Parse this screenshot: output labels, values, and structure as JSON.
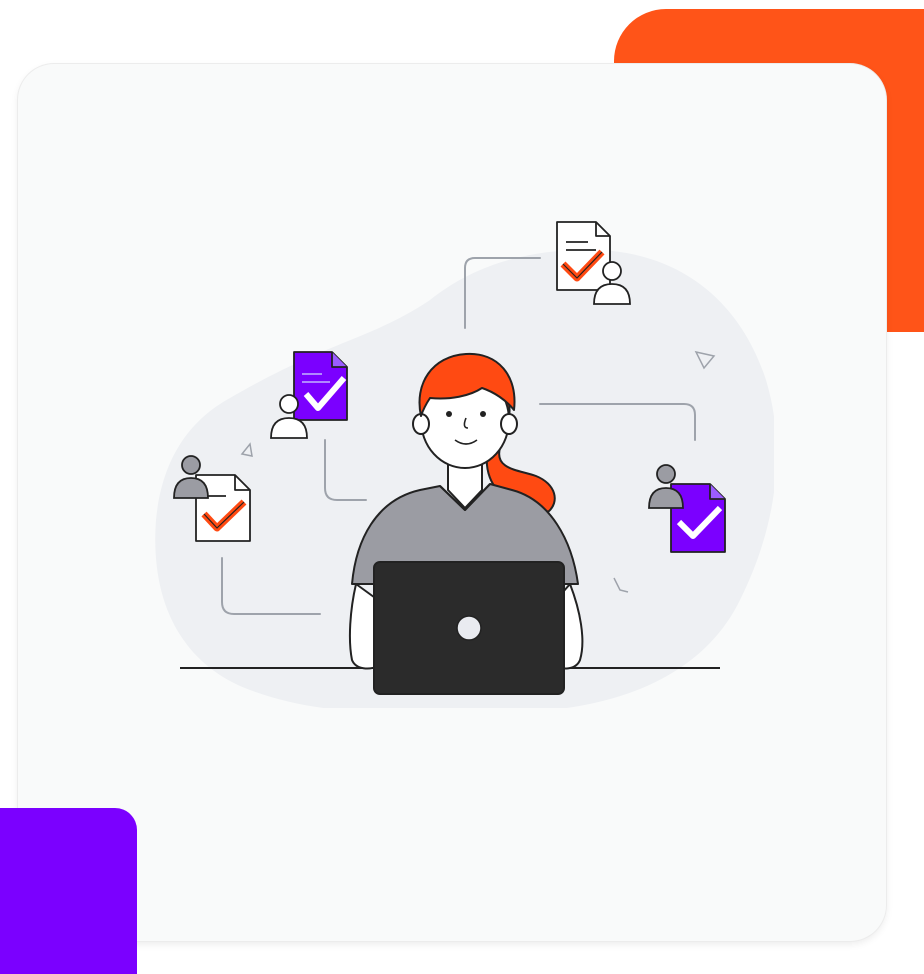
{
  "colors": {
    "accent_orange": "#ff5418",
    "accent_purple": "#7b00ff",
    "card_background": "#f9fafa",
    "blob": "#eef0f3",
    "outline": "#222222",
    "hair": "#ff4a12",
    "shirt": "#9b9ca3",
    "laptop": "#2b2b2b",
    "doc_purple": "#7b00ff"
  },
  "illustration": {
    "subject": "woman-working-on-laptop",
    "icons": [
      "document-check-icon",
      "user-icon",
      "connector-line",
      "laptop-icon"
    ]
  }
}
